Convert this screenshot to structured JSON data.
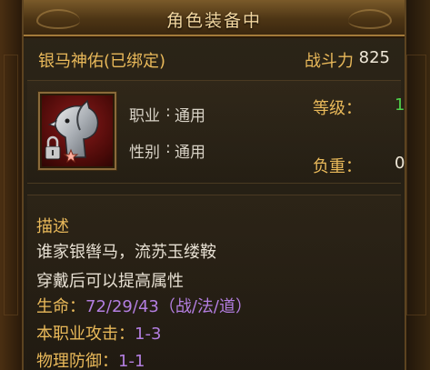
{
  "tooltip": {
    "title": "角色装备中",
    "item_name": "银马神佑(已绑定)",
    "power_label": "战斗力",
    "power_value": "825",
    "info": {
      "job_label": "职业",
      "job_value": "通用",
      "gender_label": "性别",
      "gender_value": "通用",
      "level_label": "等级：",
      "level_value": "1",
      "weight_label": "负重：",
      "weight_value": "0",
      "separator": ":"
    },
    "description": {
      "title": "描述",
      "flavor_lines": [
        "谁家银辔马，流苏玉缕鞍",
        "穿戴后可以提高属性"
      ],
      "stats": [
        {
          "label": "生命：",
          "value": "72/29/43（战/法/道）"
        },
        {
          "label": "本职业攻击：",
          "value": "1-3"
        },
        {
          "label": "物理防御：",
          "value": "1-1"
        }
      ]
    }
  },
  "colors": {
    "gold": "#e9b95a",
    "level_green": "#4fd24a",
    "stat_purple": "#b37ee0"
  },
  "icons": [
    "horse-head-icon",
    "lock-icon",
    "star-icon"
  ]
}
